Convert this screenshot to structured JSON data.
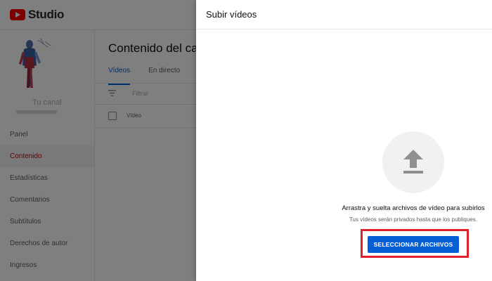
{
  "header": {
    "logo_text": "Studio"
  },
  "sidebar": {
    "channel_name": "Tu canal",
    "items": [
      {
        "label": "Panel",
        "active": false
      },
      {
        "label": "Contenido",
        "active": true
      },
      {
        "label": "Estadísticas",
        "active": false
      },
      {
        "label": "Comentarios",
        "active": false
      },
      {
        "label": "Subtítulos",
        "active": false
      },
      {
        "label": "Derechos de autor",
        "active": false
      },
      {
        "label": "Ingresos",
        "active": false
      }
    ]
  },
  "main": {
    "title": "Contenido del canal",
    "tabs": [
      {
        "label": "Vídeos",
        "active": true
      },
      {
        "label": "En directo",
        "active": false
      }
    ],
    "filter_placeholder": "Filtrar",
    "columns": {
      "video": "Vídeo"
    }
  },
  "dialog": {
    "title": "Subir vídeos",
    "drag_text": "Arrastra y suelta archivos de vídeo para subirlos",
    "private_text": "Tus vídeos serán privados hasta que los publiques.",
    "select_button": "SELECCIONAR ARCHIVOS"
  },
  "colors": {
    "accent": "#065fd4",
    "brand": "#ff0000",
    "highlight": "#e0202a"
  },
  "icons": [
    "youtube-logo-icon",
    "filter-icon",
    "upload-arrow-icon"
  ]
}
